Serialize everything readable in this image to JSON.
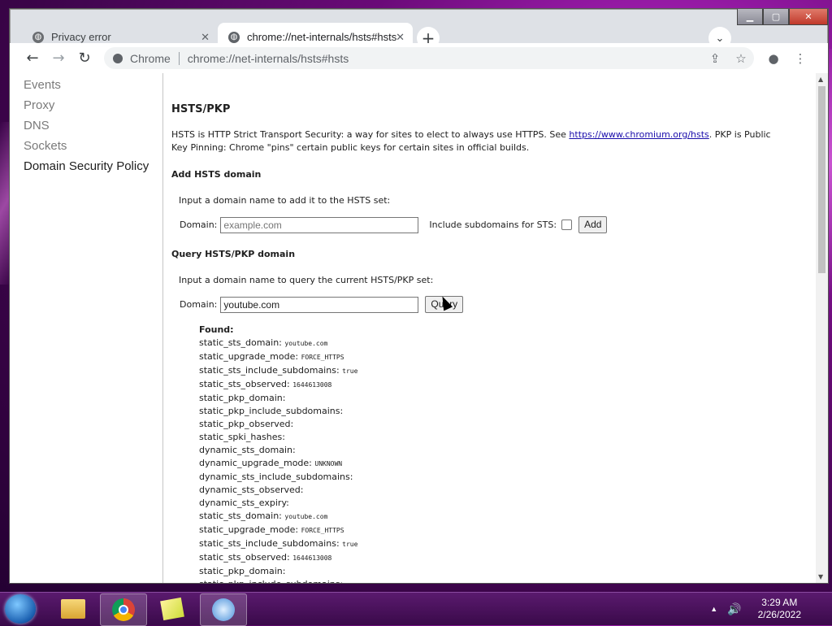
{
  "window": {
    "controls": {
      "minimize": "▁",
      "maximize": "▢",
      "close": "✕"
    }
  },
  "tabs": [
    {
      "title": "Privacy error",
      "icon": "globe-icon",
      "close": "✕",
      "active": false
    },
    {
      "title": "chrome://net-internals/hsts#hsts",
      "icon": "globe-icon",
      "close": "✕",
      "active": true
    }
  ],
  "new_tab_label": "+",
  "tab_search_label": "⌄",
  "toolbar": {
    "back": "←",
    "forward": "→",
    "reload": "↻",
    "chip_label": "Chrome",
    "url": "chrome://net-internals/hsts#hsts",
    "share": "⇪",
    "bookmark": "☆",
    "profile": "●",
    "menu": "⋮"
  },
  "sidebar": {
    "items": [
      {
        "label": "Events",
        "active": false
      },
      {
        "label": "Proxy",
        "active": false
      },
      {
        "label": "DNS",
        "active": false
      },
      {
        "label": "Sockets",
        "active": false
      },
      {
        "label": "Domain Security Policy",
        "active": true
      }
    ]
  },
  "main": {
    "title": "HSTS/PKP",
    "desc_before_link": "HSTS is HTTP Strict Transport Security: a way for sites to elect to always use HTTPS. See ",
    "desc_link": "https://www.chromium.org/hsts",
    "desc_after_link": ". PKP is Public Key Pinning: Chrome \"pins\" certain public keys for certain sites in official builds.",
    "add": {
      "heading": "Add HSTS domain",
      "instruction": "Input a domain name to add it to the HSTS set:",
      "domain_label": "Domain:",
      "domain_placeholder": "example.com",
      "include_label": "Include subdomains for STS:",
      "add_button": "Add"
    },
    "query": {
      "heading": "Query HSTS/PKP domain",
      "instruction": "Input a domain name to query the current HSTS/PKP set:",
      "domain_label": "Domain:",
      "domain_value": "youtube.com",
      "query_button": "Query"
    },
    "result": {
      "title": "Found:",
      "rows": [
        {
          "key": "static_sts_domain:",
          "value": "youtube.com"
        },
        {
          "key": "static_upgrade_mode:",
          "value": "FORCE_HTTPS"
        },
        {
          "key": "static_sts_include_subdomains:",
          "value": "true"
        },
        {
          "key": "static_sts_observed:",
          "value": "1644613008"
        },
        {
          "key": "static_pkp_domain:",
          "value": ""
        },
        {
          "key": "static_pkp_include_subdomains:",
          "value": ""
        },
        {
          "key": "static_pkp_observed:",
          "value": ""
        },
        {
          "key": "static_spki_hashes:",
          "value": ""
        },
        {
          "key": "dynamic_sts_domain:",
          "value": ""
        },
        {
          "key": "dynamic_upgrade_mode:",
          "value": "UNKNOWN"
        },
        {
          "key": "dynamic_sts_include_subdomains:",
          "value": ""
        },
        {
          "key": "dynamic_sts_observed:",
          "value": ""
        },
        {
          "key": "dynamic_sts_expiry:",
          "value": ""
        },
        {
          "key": "static_sts_domain:",
          "value": "youtube.com"
        },
        {
          "key": "static_upgrade_mode:",
          "value": "FORCE_HTTPS"
        },
        {
          "key": "static_sts_include_subdomains:",
          "value": "true"
        },
        {
          "key": "static_sts_observed:",
          "value": "1644613008"
        },
        {
          "key": "static_pkp_domain:",
          "value": ""
        },
        {
          "key": "static_pkp_include_subdomains:",
          "value": ""
        }
      ]
    }
  },
  "taskbar": {
    "items": [
      "folder-icon",
      "chrome-icon",
      "sticky-notes-icon",
      "clock-icon"
    ],
    "tray_arrow": "▲",
    "volume": "🔊",
    "time": "3:29 AM",
    "date": "2/26/2022"
  },
  "colors": {
    "link": "#1a0dab",
    "desktop": "#6a0a78",
    "tab_strip": "#dee1e6"
  }
}
